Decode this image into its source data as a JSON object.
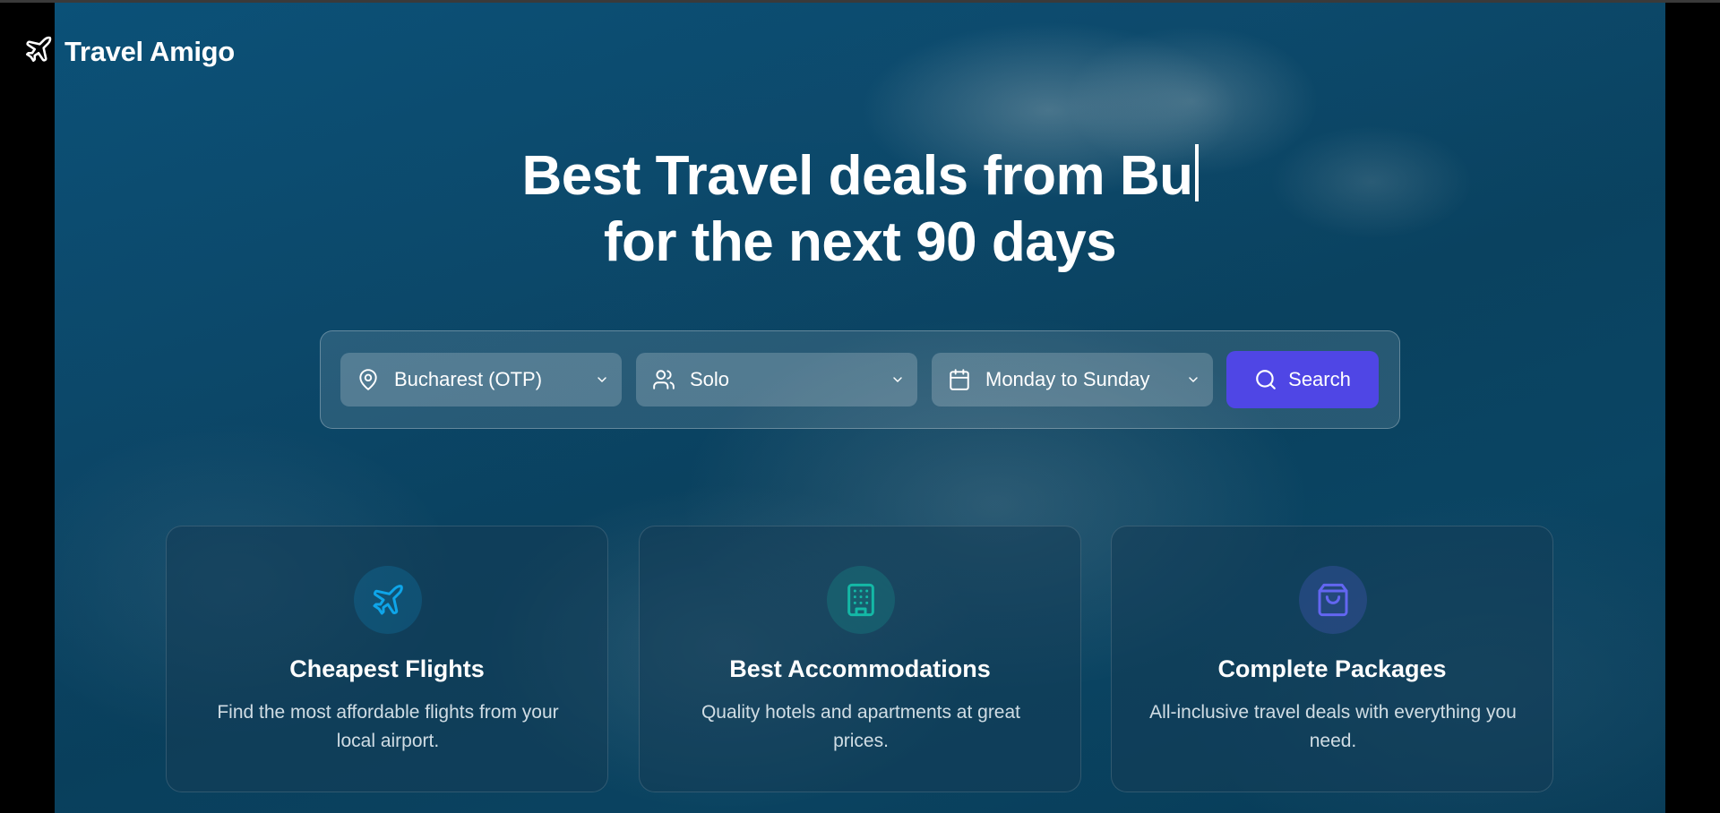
{
  "brand": {
    "name": "Travel Amigo",
    "icon": "plane-icon"
  },
  "hero": {
    "headline_line1": "Best Travel deals from Bu",
    "headline_line2": "for the next 90 days"
  },
  "search": {
    "origin": {
      "value": "Bucharest (OTP)",
      "icon": "map-pin-icon"
    },
    "travelers": {
      "value": "Solo",
      "icon": "users-icon"
    },
    "dates": {
      "value": "Monday to Sunday",
      "icon": "calendar-icon"
    },
    "button_label": "Search",
    "button_color": "#4f46e5"
  },
  "features": [
    {
      "title": "Cheapest Flights",
      "description": "Find the most affordable flights from your local airport.",
      "icon": "plane-icon",
      "accent": "#0ea5e9"
    },
    {
      "title": "Best Accommodations",
      "description": "Quality hotels and apartments at great prices.",
      "icon": "building-icon",
      "accent": "#14b8a6"
    },
    {
      "title": "Complete Packages",
      "description": "All-inclusive travel deals with everything you need.",
      "icon": "shopping-bag-icon",
      "accent": "#6366f1"
    }
  ]
}
